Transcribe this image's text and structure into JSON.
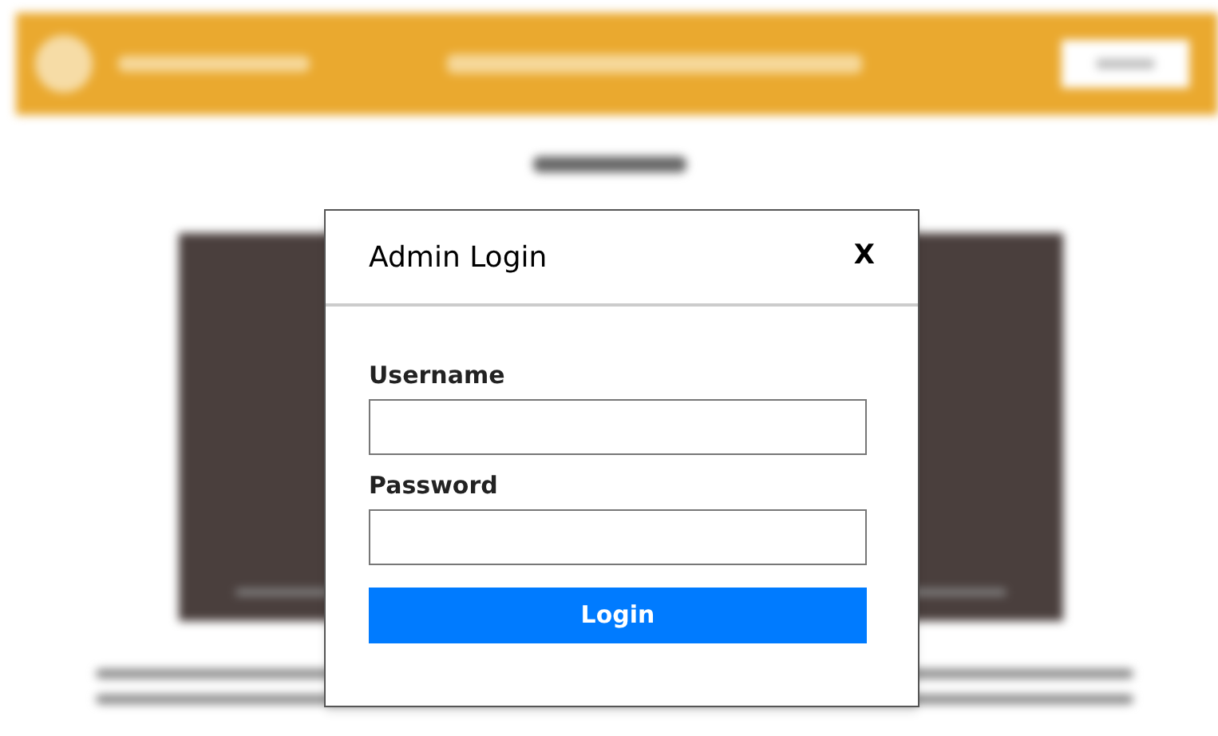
{
  "modal": {
    "title": "Admin Login",
    "close": "X",
    "fields": [
      {
        "label": "Username"
      },
      {
        "label": "Password"
      }
    ],
    "submit": "Login"
  }
}
